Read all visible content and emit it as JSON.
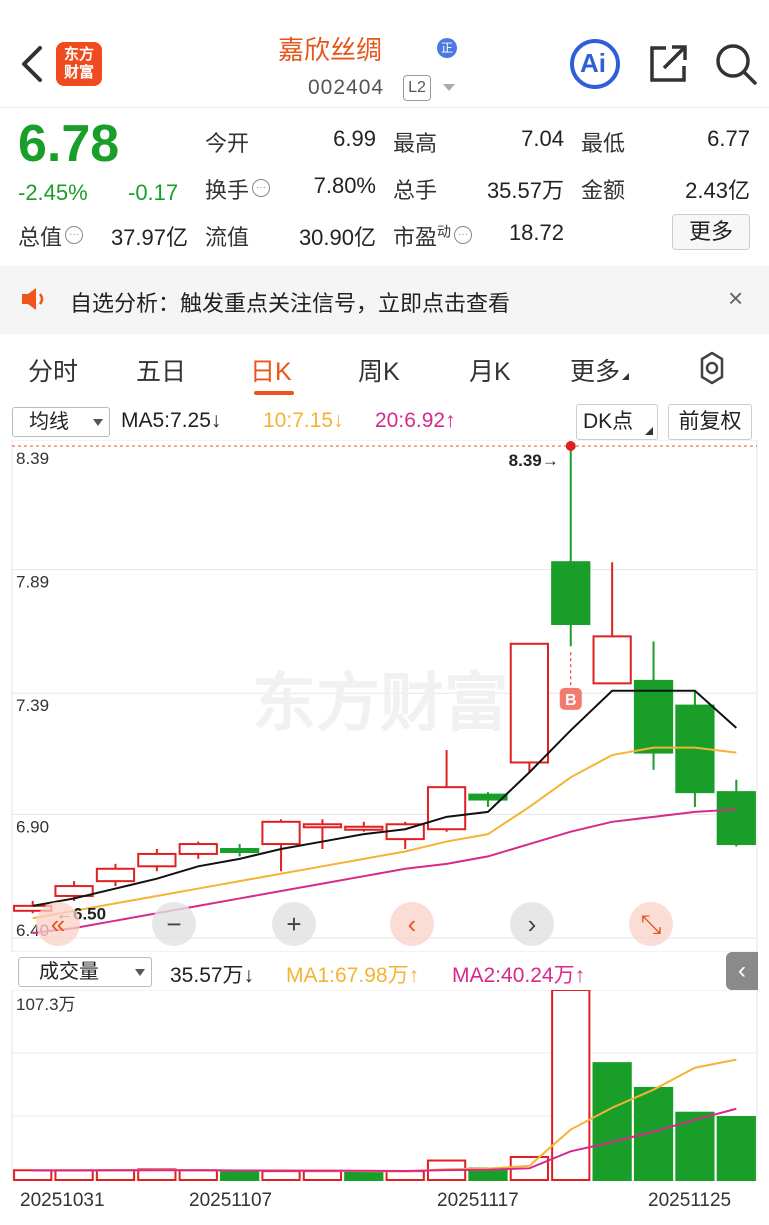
{
  "header": {
    "logo_line1": "东方",
    "logo_line2": "财富",
    "stock_name": "嘉欣丝绸",
    "badge": "正",
    "stock_code": "002404",
    "level": "L2",
    "ai_label": "Ai"
  },
  "quote": {
    "price": "6.78",
    "change_pct": "-2.45%",
    "change": "-0.17",
    "fields": [
      {
        "label": "今开",
        "value": "6.99",
        "color": "red"
      },
      {
        "label": "最高",
        "value": "7.04",
        "color": "red"
      },
      {
        "label": "最低",
        "value": "6.77",
        "color": "green"
      },
      {
        "label": "换手",
        "value": "7.80%",
        "color": "black"
      },
      {
        "label": "总手",
        "value": "35.57万",
        "color": "black"
      },
      {
        "label": "金额",
        "value": "2.43亿",
        "color": "black"
      },
      {
        "label": "总值",
        "value": "37.97亿",
        "color": "black"
      },
      {
        "label": "流值",
        "value": "30.90亿",
        "color": "black"
      },
      {
        "label": "市盈",
        "sup": "动",
        "value": "18.72",
        "color": "black"
      }
    ],
    "more_label": "更多"
  },
  "notice": {
    "text": "自选分析：触发重点关注信号，立即点击查看",
    "close": "×"
  },
  "tabs": [
    "分时",
    "五日",
    "日K",
    "周K",
    "月K",
    "更多"
  ],
  "active_tab": "日K",
  "indicator_bar": {
    "select_label": "均线",
    "ma5": "MA5:7.25↓",
    "ma10": "10:7.15↓",
    "ma20": "20:6.92↑",
    "dk_label": "DK点",
    "fq_label": "前复权"
  },
  "colors": {
    "up": "#e02020",
    "down": "#1a9e2a",
    "ma5": "#111111",
    "ma10": "#f5b332",
    "ma20": "#d9288c",
    "accent": "#e8541a"
  },
  "chart_data": {
    "type": "candlestick",
    "price_axis_labels": [
      "8.39",
      "7.89",
      "7.39",
      "6.90",
      "6.40"
    ],
    "ylim": [
      6.4,
      8.39
    ],
    "max_annotation": "8.39→",
    "min_annotation": "←6.50",
    "buy_marker": "B",
    "watermark": "东方财富",
    "candles": [
      {
        "o": 6.51,
        "c": 6.53,
        "h": 6.55,
        "l": 6.5
      },
      {
        "o": 6.57,
        "c": 6.61,
        "h": 6.63,
        "l": 6.55
      },
      {
        "o": 6.63,
        "c": 6.68,
        "h": 6.7,
        "l": 6.61
      },
      {
        "o": 6.69,
        "c": 6.74,
        "h": 6.76,
        "l": 6.67
      },
      {
        "o": 6.74,
        "c": 6.78,
        "h": 6.79,
        "l": 6.72
      },
      {
        "o": 6.76,
        "c": 6.75,
        "h": 6.78,
        "l": 6.73
      },
      {
        "o": 6.78,
        "c": 6.87,
        "h": 6.88,
        "l": 6.67
      },
      {
        "o": 6.85,
        "c": 6.86,
        "h": 6.88,
        "l": 6.76
      },
      {
        "o": 6.85,
        "c": 6.85,
        "h": 6.87,
        "l": 6.83
      },
      {
        "o": 6.8,
        "c": 6.86,
        "h": 6.87,
        "l": 6.76
      },
      {
        "o": 6.84,
        "c": 7.01,
        "h": 7.16,
        "l": 6.83
      },
      {
        "o": 6.98,
        "c": 6.96,
        "h": 6.99,
        "l": 6.93
      },
      {
        "o": 7.11,
        "c": 7.59,
        "h": 7.59,
        "l": 7.07
      },
      {
        "o": 7.92,
        "c": 7.67,
        "h": 8.39,
        "l": 7.58
      },
      {
        "o": 7.43,
        "c": 7.62,
        "h": 7.92,
        "l": 7.43
      },
      {
        "o": 7.44,
        "c": 7.15,
        "h": 7.6,
        "l": 7.08
      },
      {
        "o": 7.34,
        "c": 6.99,
        "h": 7.4,
        "l": 6.93
      },
      {
        "o": 6.99,
        "c": 6.78,
        "h": 7.04,
        "l": 6.77
      }
    ],
    "ma5": [
      6.53,
      6.56,
      6.6,
      6.64,
      6.69,
      6.72,
      6.76,
      6.79,
      6.82,
      6.84,
      6.89,
      6.91,
      7.07,
      7.24,
      7.4,
      7.4,
      7.4,
      7.25
    ],
    "ma10": [
      6.48,
      6.51,
      6.54,
      6.57,
      6.6,
      6.63,
      6.66,
      6.69,
      6.72,
      6.75,
      6.79,
      6.82,
      6.93,
      7.05,
      7.14,
      7.17,
      7.17,
      7.15
    ],
    "ma20": [
      6.42,
      6.44,
      6.47,
      6.5,
      6.53,
      6.56,
      6.59,
      6.62,
      6.65,
      6.68,
      6.7,
      6.73,
      6.78,
      6.83,
      6.87,
      6.89,
      6.91,
      6.92
    ]
  },
  "volume": {
    "select_label": "成交量",
    "value": "35.57万↓",
    "ma1": "MA1:67.98万↑",
    "ma2": "MA2:40.24万↑",
    "axis_max_label": "107.3万",
    "ylim": [
      0,
      107.3
    ],
    "bars": [
      {
        "v": 5.5,
        "up": true
      },
      {
        "v": 5.5,
        "up": true
      },
      {
        "v": 5.5,
        "up": true
      },
      {
        "v": 6.0,
        "up": true
      },
      {
        "v": 5.5,
        "up": true
      },
      {
        "v": 4.5,
        "up": false
      },
      {
        "v": 5.0,
        "up": true
      },
      {
        "v": 5.0,
        "up": true
      },
      {
        "v": 4.5,
        "up": false
      },
      {
        "v": 5.0,
        "up": true
      },
      {
        "v": 11.0,
        "up": true
      },
      {
        "v": 6.5,
        "up": false
      },
      {
        "v": 13.0,
        "up": true
      },
      {
        "v": 107.3,
        "up": true
      },
      {
        "v": 66.0,
        "up": false
      },
      {
        "v": 52.0,
        "up": false
      },
      {
        "v": 38.0,
        "up": false
      },
      {
        "v": 35.57,
        "up": false
      }
    ],
    "ma1_line": [
      5.4,
      5.5,
      5.5,
      5.6,
      5.6,
      5.4,
      5.3,
      5.2,
      5.0,
      4.8,
      6.1,
      6.4,
      8.0,
      28.5,
      40.8,
      51.0,
      63.4,
      67.98
    ],
    "ma2_line": [
      5.4,
      5.4,
      5.5,
      5.5,
      5.5,
      5.4,
      5.3,
      5.3,
      5.2,
      5.1,
      5.6,
      5.8,
      6.6,
      16.2,
      21.4,
      27.3,
      34.0,
      40.24
    ],
    "date_labels": [
      "20251031",
      "20251107",
      "20251117",
      "20251125"
    ]
  },
  "chart_buttons": [
    "«",
    "−",
    "+",
    "‹",
    "›",
    "⤡"
  ]
}
